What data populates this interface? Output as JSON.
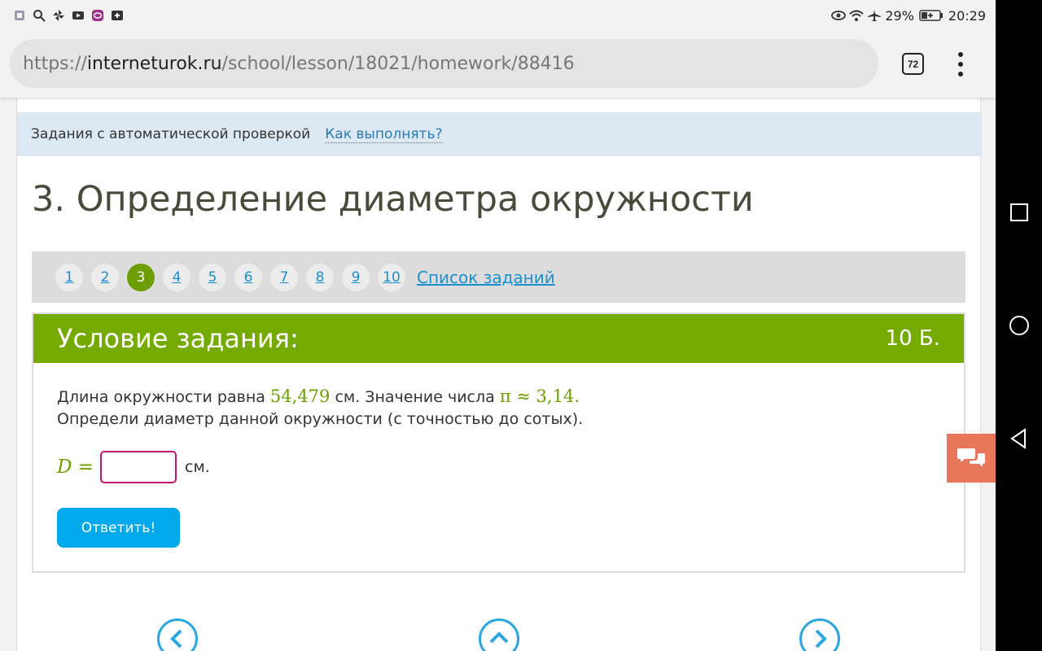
{
  "status_bar": {
    "battery": "29%",
    "time": "20:29"
  },
  "browser": {
    "url_prefix": "https://",
    "url_domain": "interneturok.ru",
    "url_path": "/school/lesson/18021/homework/88416",
    "tab_count": "72"
  },
  "page": {
    "info_text": "Задания с автоматической проверкой",
    "how_link": "Как выполнять?",
    "title": "3. Определение диаметра окружности",
    "pager": {
      "pages": [
        "1",
        "2",
        "3",
        "4",
        "5",
        "6",
        "7",
        "8",
        "9",
        "10"
      ],
      "active": "3",
      "list_link": "Список заданий"
    },
    "task": {
      "header": "Условие задания:",
      "score": "10 Б.",
      "line1_before": "Длина окружности равна ",
      "line1_value": "54,479",
      "line1_middle": " см. Значение числа ",
      "line1_pi": "π ≈ 3,14.",
      "line2": "Определи диаметр данной окружности (с точностью до сотых).",
      "answer_var": "D =",
      "answer_value": "",
      "answer_unit": "см.",
      "submit_label": "Ответить!"
    }
  },
  "colors": {
    "accent_green": "#75aa00",
    "link_blue": "#1a8fd0",
    "button_blue": "#00a8ec",
    "input_border": "#c0166f",
    "chat_orange": "#e8775a"
  }
}
